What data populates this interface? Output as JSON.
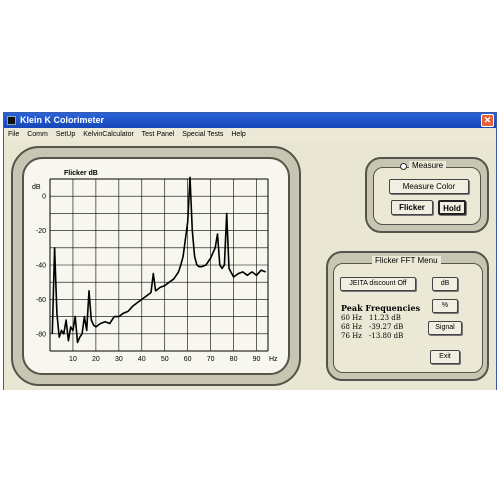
{
  "window": {
    "title": "Klein K Colorimeter",
    "close_glyph": "✕"
  },
  "menu": [
    "File",
    "Comm",
    "SetUp",
    "KelvinCalculator",
    "Test Panel",
    "Special Tests",
    "Help"
  ],
  "chart_data": {
    "type": "line",
    "title": "Flicker dB",
    "ylabel": "dB",
    "xlabel": "Hz",
    "xlim": [
      0,
      95
    ],
    "ylim": [
      -90,
      10
    ],
    "x_ticks": [
      10,
      20,
      30,
      40,
      50,
      60,
      70,
      80,
      90
    ],
    "y_ticks": [
      0,
      -20,
      -40,
      -60,
      -80
    ],
    "series": [
      {
        "x": [
          1,
          2,
          3,
          4,
          5,
          6,
          7,
          8,
          9,
          10,
          11,
          12,
          13,
          14,
          15,
          16,
          17,
          18,
          19,
          20,
          22,
          24,
          26,
          28,
          30,
          32,
          34,
          36,
          38,
          40,
          42,
          44,
          45,
          46,
          47,
          48,
          50,
          52,
          54,
          56,
          57,
          58,
          59,
          60,
          61,
          62,
          63,
          64,
          65,
          66,
          68,
          70,
          72,
          73,
          74,
          75,
          76,
          77,
          78,
          80,
          82,
          84,
          86,
          88,
          90,
          92,
          94
        ],
        "y": [
          -80,
          -30,
          -68,
          -82,
          -78,
          -80,
          -72,
          -84,
          -76,
          -78,
          -70,
          -85,
          -82,
          -80,
          -70,
          -78,
          -55,
          -72,
          -75,
          -76,
          -74,
          -73,
          -74,
          -70,
          -70,
          -68,
          -67,
          -64,
          -62,
          -60,
          -58,
          -56,
          -45,
          -55,
          -54,
          -53,
          -52,
          -50,
          -48,
          -44,
          -40,
          -35,
          -25,
          -15,
          11,
          -20,
          -35,
          -40,
          -41,
          -41,
          -40,
          -36,
          -30,
          -22,
          -40,
          -42,
          -40,
          -10,
          -42,
          -47,
          -45,
          -44,
          -46,
          -44,
          -46,
          -43,
          -44
        ]
      }
    ]
  },
  "measure": {
    "title": "Measure",
    "measure_color": "Measure Color",
    "flicker": "Flicker",
    "hold": "Hold"
  },
  "fft": {
    "title": "Flicker FFT Menu",
    "jeita": "JEITA discount Off",
    "db": "dB",
    "percent": "%",
    "signal": "Signal",
    "exit": "Exit",
    "peaks_title": "Peak Frequencies",
    "peaks": [
      {
        "freq": "60 Hz",
        "value": "11.23 dB"
      },
      {
        "freq": "68 Hz",
        "value": "-39.27 dB"
      },
      {
        "freq": "76 Hz",
        "value": "-13.80 dB"
      }
    ]
  }
}
